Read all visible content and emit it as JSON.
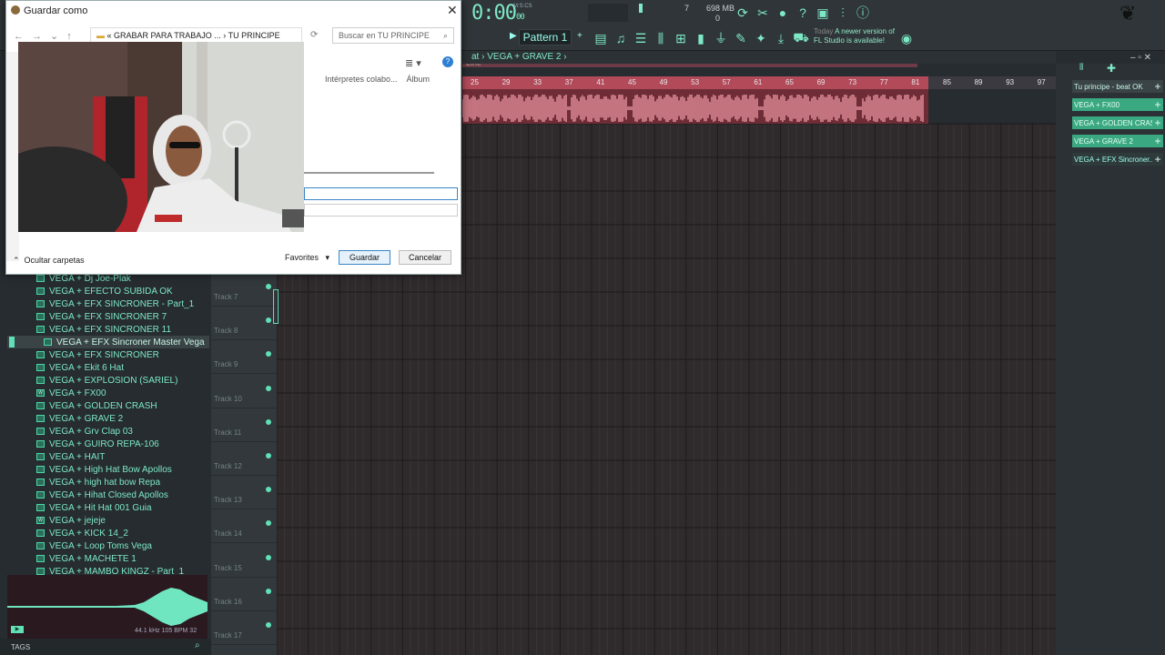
{
  "toolbar": {
    "time": "0:00",
    "time_ms": "00",
    "time_unit": "M:S:CS",
    "cpu_value": "7",
    "memory": "698 MB",
    "voices": "0",
    "line_mode": "Line",
    "pattern": "Pattern 1",
    "news_day": "Today",
    "news_text": "A newer version of FL Studio is available!"
  },
  "playlist": {
    "breadcrumb": "at  ›  VEGA + GRAVE 2  ›",
    "ruler": [
      "25",
      "29",
      "33",
      "37",
      "41",
      "45",
      "49",
      "53",
      "57",
      "61",
      "65",
      "69",
      "73",
      "77",
      "81",
      "85",
      "89",
      "93",
      "97"
    ],
    "tracks": [
      "Track 7",
      "Track 8",
      "Track 9",
      "Track 10",
      "Track 11",
      "Track 12",
      "Track 13",
      "Track 14",
      "Track 15",
      "Track 16",
      "Track 17"
    ]
  },
  "browser": {
    "items": [
      {
        "label": "VEGA + Dj Joe-Plak",
        "icon": "wave"
      },
      {
        "label": "VEGA + EFECTO SUBIDA OK",
        "icon": "wave"
      },
      {
        "label": "VEGA + EFX SINCRONER - Part_1",
        "icon": "wave"
      },
      {
        "label": "VEGA + EFX SINCRONER 7",
        "icon": "wave"
      },
      {
        "label": "VEGA + EFX SINCRONER 11",
        "icon": "wave"
      },
      {
        "label": "VEGA + EFX Sincroner Master Vega",
        "icon": "wave",
        "selected": true
      },
      {
        "label": "VEGA + EFX SINCRONER",
        "icon": "wave"
      },
      {
        "label": "VEGA + Ekit 6 Hat",
        "icon": "wave"
      },
      {
        "label": "VEGA + EXPLOSION (SARIEL)",
        "icon": "wave"
      },
      {
        "label": "VEGA + FX00",
        "icon": "wav"
      },
      {
        "label": "VEGA + GOLDEN CRASH",
        "icon": "wave"
      },
      {
        "label": "VEGA + GRAVE 2",
        "icon": "wave"
      },
      {
        "label": "VEGA + Grv Clap 03",
        "icon": "wave"
      },
      {
        "label": "VEGA + GUIRO REPA-106",
        "icon": "wave"
      },
      {
        "label": "VEGA + HAIT",
        "icon": "wave"
      },
      {
        "label": "VEGA + High Hat Bow Apollos",
        "icon": "wave"
      },
      {
        "label": "VEGA + high hat bow Repa",
        "icon": "wave"
      },
      {
        "label": "VEGA + Hihat Closed Apollos",
        "icon": "wave"
      },
      {
        "label": "VEGA + Hit Hat 001 Guia",
        "icon": "wave"
      },
      {
        "label": "VEGA + jejeje",
        "icon": "wav"
      },
      {
        "label": "VEGA + KICK 14_2",
        "icon": "wave"
      },
      {
        "label": "VEGA + Loop Toms Vega",
        "icon": "wave"
      },
      {
        "label": "VEGA + MACHETE 1",
        "icon": "wave"
      },
      {
        "label": "VEGA + MAMBO KINGZ - Part_1",
        "icon": "wave"
      }
    ],
    "sample_info": "44.1 kHz 105 BPM 32",
    "tags_label": "TAGS"
  },
  "channels": [
    "Tu principe - beat OK",
    "VEGA + FX00",
    "VEGA + GOLDEN CRASH",
    "VEGA + GRAVE 2",
    "VEGA + EFX Sincroner..."
  ],
  "dialog": {
    "title": "Guardar como",
    "path_prefix": "«",
    "path_parent": "GRABAR PARA TRABAJO ...",
    "path_current": "TU PRINCIPE",
    "search_placeholder": "Buscar en TU PRINCIPE",
    "columns": [
      "Intérpretes colabo...",
      "Álbum"
    ],
    "hide_folders": "Ocultar carpetas",
    "favorites": "Favorites",
    "save": "Guardar",
    "cancel": "Cancelar"
  },
  "colors": {
    "accent": "#7fe9c7",
    "clip": "#d98590",
    "ruler_active": "#b24a5a",
    "dialog_primary": "#3a86c8"
  }
}
